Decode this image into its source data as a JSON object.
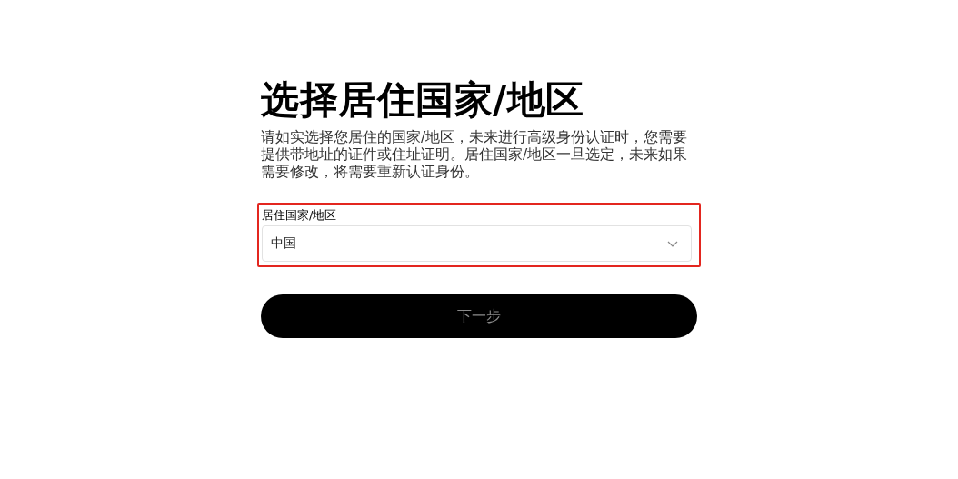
{
  "title": "选择居住国家/地区",
  "description": "请如实选择您居住的国家/地区，未来进行高级身份认证时，您需要提供带地址的证件或住址证明。居住国家/地区一旦选定，未来如果需要修改，将需要重新认证身份。",
  "field": {
    "label": "居住国家/地区",
    "value": "中国",
    "highlighted": true
  },
  "next_button": {
    "label": "下一步",
    "disabled": true
  }
}
